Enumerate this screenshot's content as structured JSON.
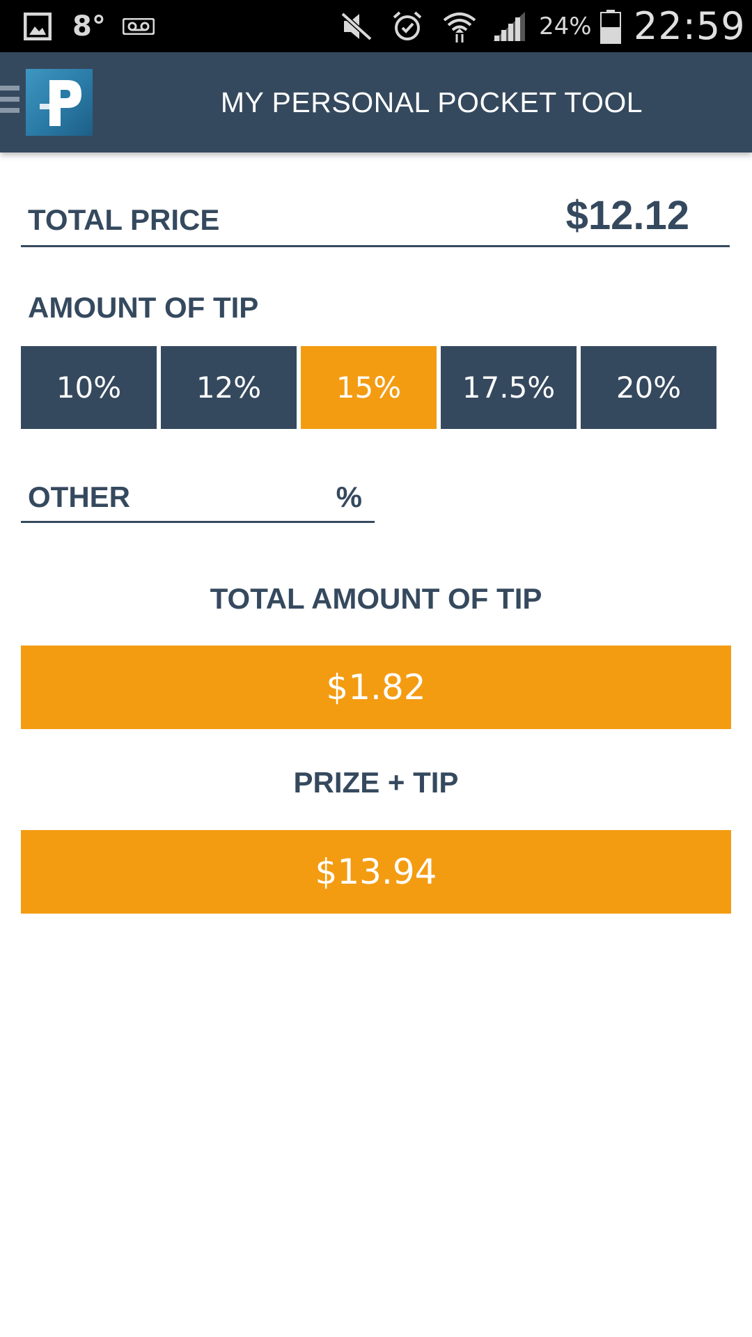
{
  "status_bar": {
    "temperature": "8°",
    "battery_percent": "24%",
    "clock": "22:59",
    "icons": [
      "gallery-icon",
      "voicemail-icon",
      "mute-icon",
      "alarm-icon",
      "wifi-icon",
      "signal-icon",
      "battery-icon"
    ]
  },
  "app_bar": {
    "title": "MY PERSONAL POCKET TOOL",
    "logo_letter": "P"
  },
  "total_price": {
    "label": "TOTAL PRICE",
    "value": "$12.12"
  },
  "tip": {
    "label": "AMOUNT OF TIP",
    "options": [
      "10%",
      "12%",
      "15%",
      "17.5%",
      "20%"
    ],
    "selected": "15%"
  },
  "other": {
    "label": "OTHER",
    "unit": "%"
  },
  "results": {
    "total_tip_label": "TOTAL AMOUNT OF TIP",
    "total_tip_value": "$1.82",
    "prize_tip_label": "PRIZE + TIP",
    "prize_tip_value": "$13.94"
  },
  "colors": {
    "primary": "#35495e",
    "accent": "#f39c12",
    "status_bar": "#000000"
  }
}
